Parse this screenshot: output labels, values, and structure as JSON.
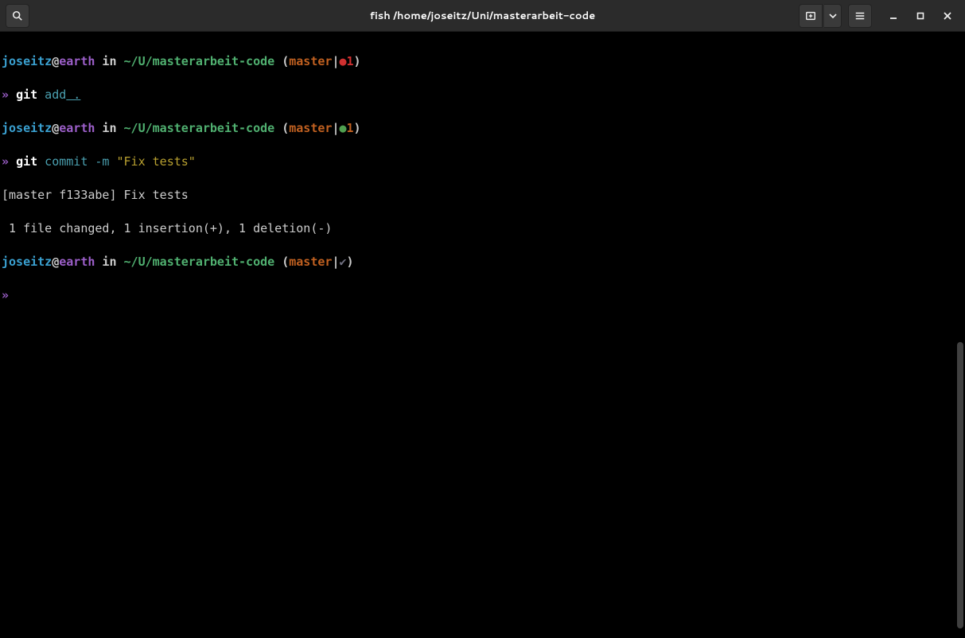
{
  "titlebar": {
    "title": "fish /home/joseitz/Uni/masterarbeit-code"
  },
  "prompt": {
    "user": "joseitz",
    "at": "@",
    "host": "earth",
    "in": " in ",
    "path": "~/U/masterarbeit-code",
    "paren_open": " (",
    "branch": "master",
    "pipe": "|",
    "paren_close": ")",
    "caret": "» "
  },
  "status": {
    "dirty_dot": "●",
    "dirty_count": "1",
    "staged_dot": "●",
    "staged_count": "1",
    "clean_check": "✔"
  },
  "commands": {
    "git_add": "git",
    "git_add_sub": " add",
    "git_add_arg": " .",
    "git_commit": "git",
    "git_commit_sub": " commit -m",
    "git_commit_msg": " \"Fix tests\""
  },
  "output": {
    "line1": "[master f133abe] Fix tests",
    "line2": " 1 file changed, 1 insertion(+), 1 deletion(-)"
  }
}
